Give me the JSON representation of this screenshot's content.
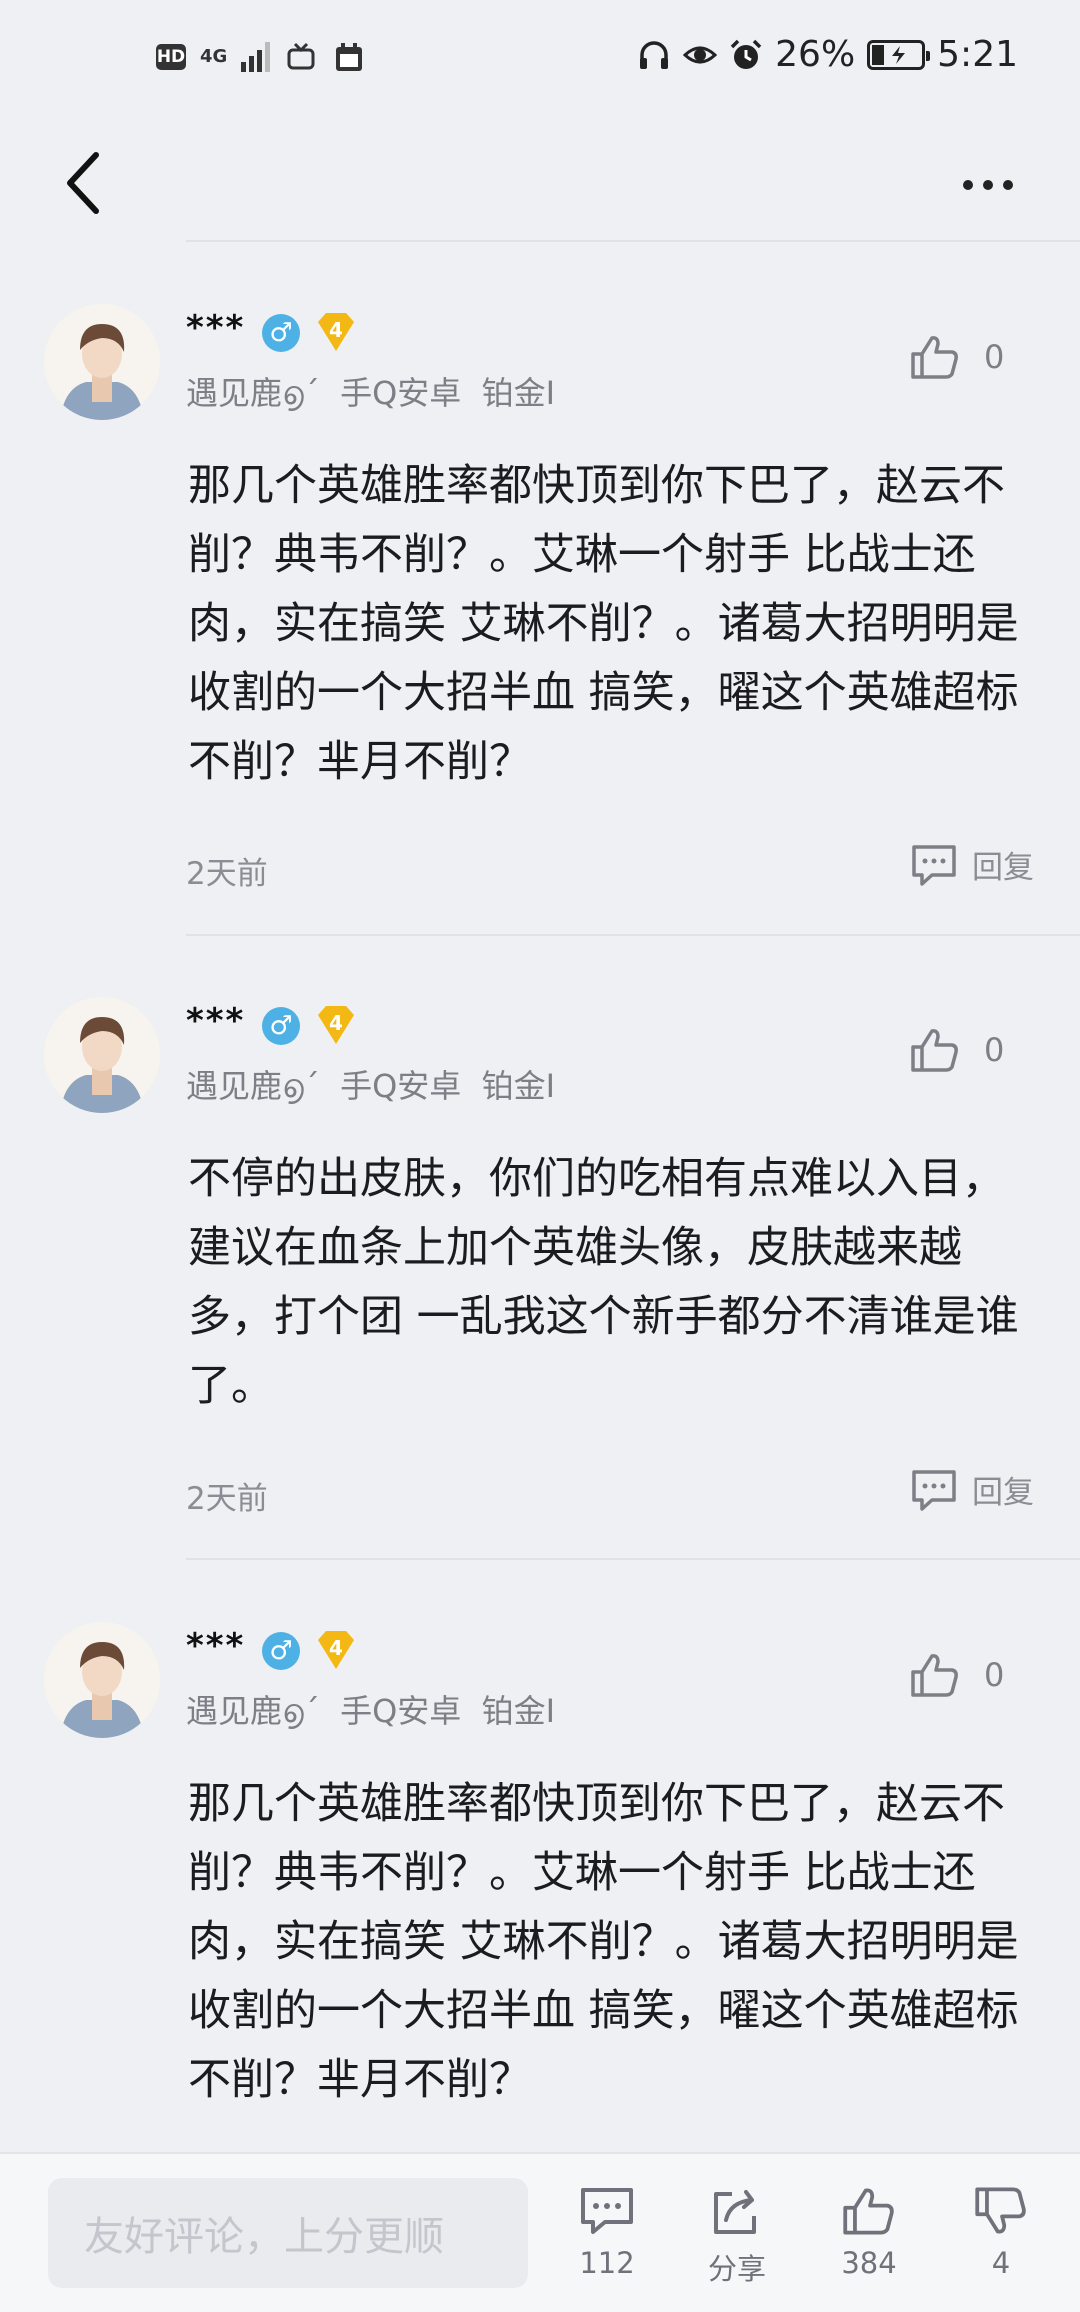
{
  "status_bar": {
    "hd": "HD",
    "network": "4G",
    "battery": "26%",
    "time": "5:21"
  },
  "comments": [
    {
      "user": "***",
      "gender": "♂",
      "level": "4",
      "meta": "遇见鹿൭´  手Q安卓  铂金I",
      "likes": "0",
      "text": "那几个英雄胜率都快顶到你下巴了，赵云不削？典韦不削？。艾琳一个射手 比战士还肉，实在搞笑 艾琳不削？。诸葛大招明明是收割的一个大招半血 搞笑，曜这个英雄超标不削？芈月不削？",
      "time": "2天前",
      "reply": "回复"
    },
    {
      "user": "***",
      "gender": "♂",
      "level": "4",
      "meta": "遇见鹿൭´  手Q安卓  铂金I",
      "likes": "0",
      "text": "不停的出皮肤，你们的吃相有点难以入目，建议在血条上加个英雄头像，皮肤越来越多，打个团 一乱我这个新手都分不清谁是谁了。",
      "time": "2天前",
      "reply": "回复"
    },
    {
      "user": "***",
      "gender": "♂",
      "level": "4",
      "meta": "遇见鹿൭´  手Q安卓  铂金I",
      "likes": "0",
      "text": "那几个英雄胜率都快顶到你下巴了，赵云不削？典韦不削？。艾琳一个射手 比战士还肉，实在搞笑 艾琳不削？。诸葛大招明明是收割的一个大招半血 搞笑，曜这个英雄超标不削？芈月不削？"
    }
  ],
  "bottom_bar": {
    "placeholder": "友好评论，上分更顺",
    "comments_count": "112",
    "share_label": "分享",
    "likes_count": "384",
    "dislikes_count": "4"
  }
}
